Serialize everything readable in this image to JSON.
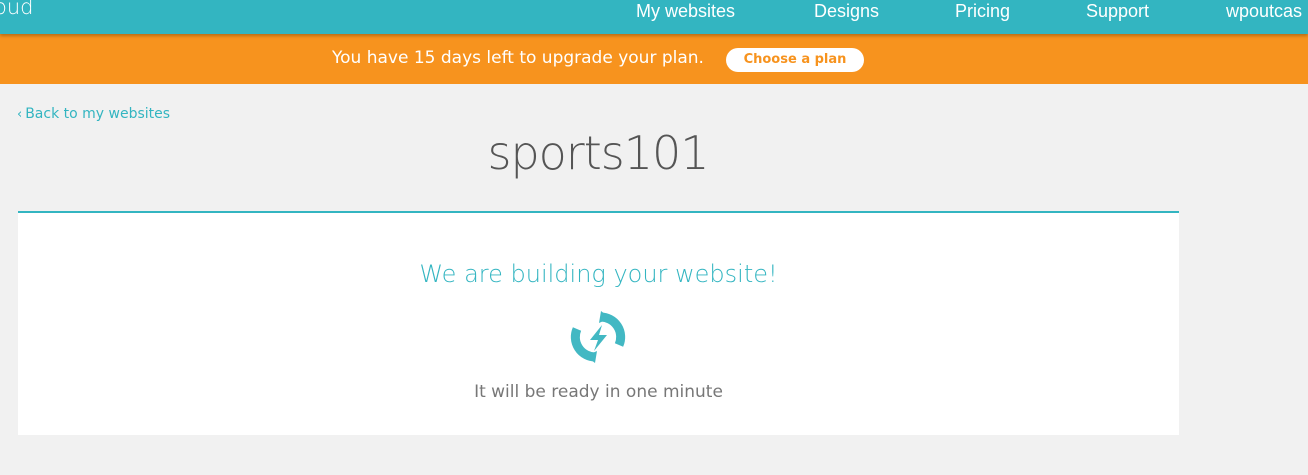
{
  "header": {
    "logo_text": "oud",
    "nav": [
      {
        "label": "My websites"
      },
      {
        "label": "Designs"
      },
      {
        "label": "Pricing"
      },
      {
        "label": "Support"
      },
      {
        "label": "wpoutcas"
      }
    ]
  },
  "banner": {
    "message": "You have 15 days left to upgrade your plan.",
    "button_label": "Choose a plan"
  },
  "back_link": {
    "chevron": "‹",
    "label": "Back to my websites"
  },
  "site": {
    "name": "sports101"
  },
  "status": {
    "heading": "We are building your website!",
    "icon": "loading-spinner-icon",
    "subtext": "It will be ready in one minute"
  },
  "colors": {
    "accent_teal": "#33b5c1",
    "banner_orange": "#f7931e",
    "page_bg": "#f1f1f1",
    "panel_bg": "#ffffff",
    "title_gray": "#555555"
  }
}
